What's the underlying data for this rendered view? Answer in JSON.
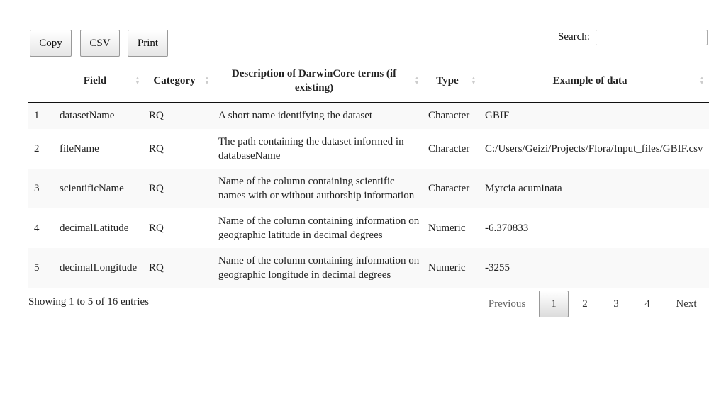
{
  "toolbar": {
    "buttons": [
      "Copy",
      "CSV",
      "Print"
    ]
  },
  "search": {
    "label": "Search:",
    "value": ""
  },
  "table": {
    "columns": [
      "",
      "Field",
      "Category",
      "Description of DarwinCore terms (if existing)",
      "Type",
      "Example of data"
    ],
    "rows": [
      [
        "1",
        "datasetName",
        "RQ",
        "A short name identifying the dataset",
        "Character",
        "GBIF"
      ],
      [
        "2",
        "fileName",
        "RQ",
        "The path containing the dataset informed in databaseName",
        "Character",
        "C:/Users/Geizi/Projects/Flora/Input_files/GBIF.csv"
      ],
      [
        "3",
        "scientificName",
        "RQ",
        "Name of the column containing scientific names with or without authorship information",
        "Character",
        "Myrcia acuminata"
      ],
      [
        "4",
        "decimalLatitude",
        "RQ",
        "Name of the column containing information on geographic latitude in decimal degrees",
        "Numeric",
        "-6.370833"
      ],
      [
        "5",
        "decimalLongitude",
        "RQ",
        "Name of the column containing information on geographic longitude in decimal degrees",
        "Numeric",
        "-3255"
      ]
    ]
  },
  "footer": {
    "info": "Showing 1 to 5 of 16 entries",
    "pagination": {
      "previous": "Previous",
      "pages": [
        "1",
        "2",
        "3",
        "4"
      ],
      "current": "1",
      "next": "Next"
    }
  },
  "icons": {
    "sort": "sort-both-icon"
  }
}
